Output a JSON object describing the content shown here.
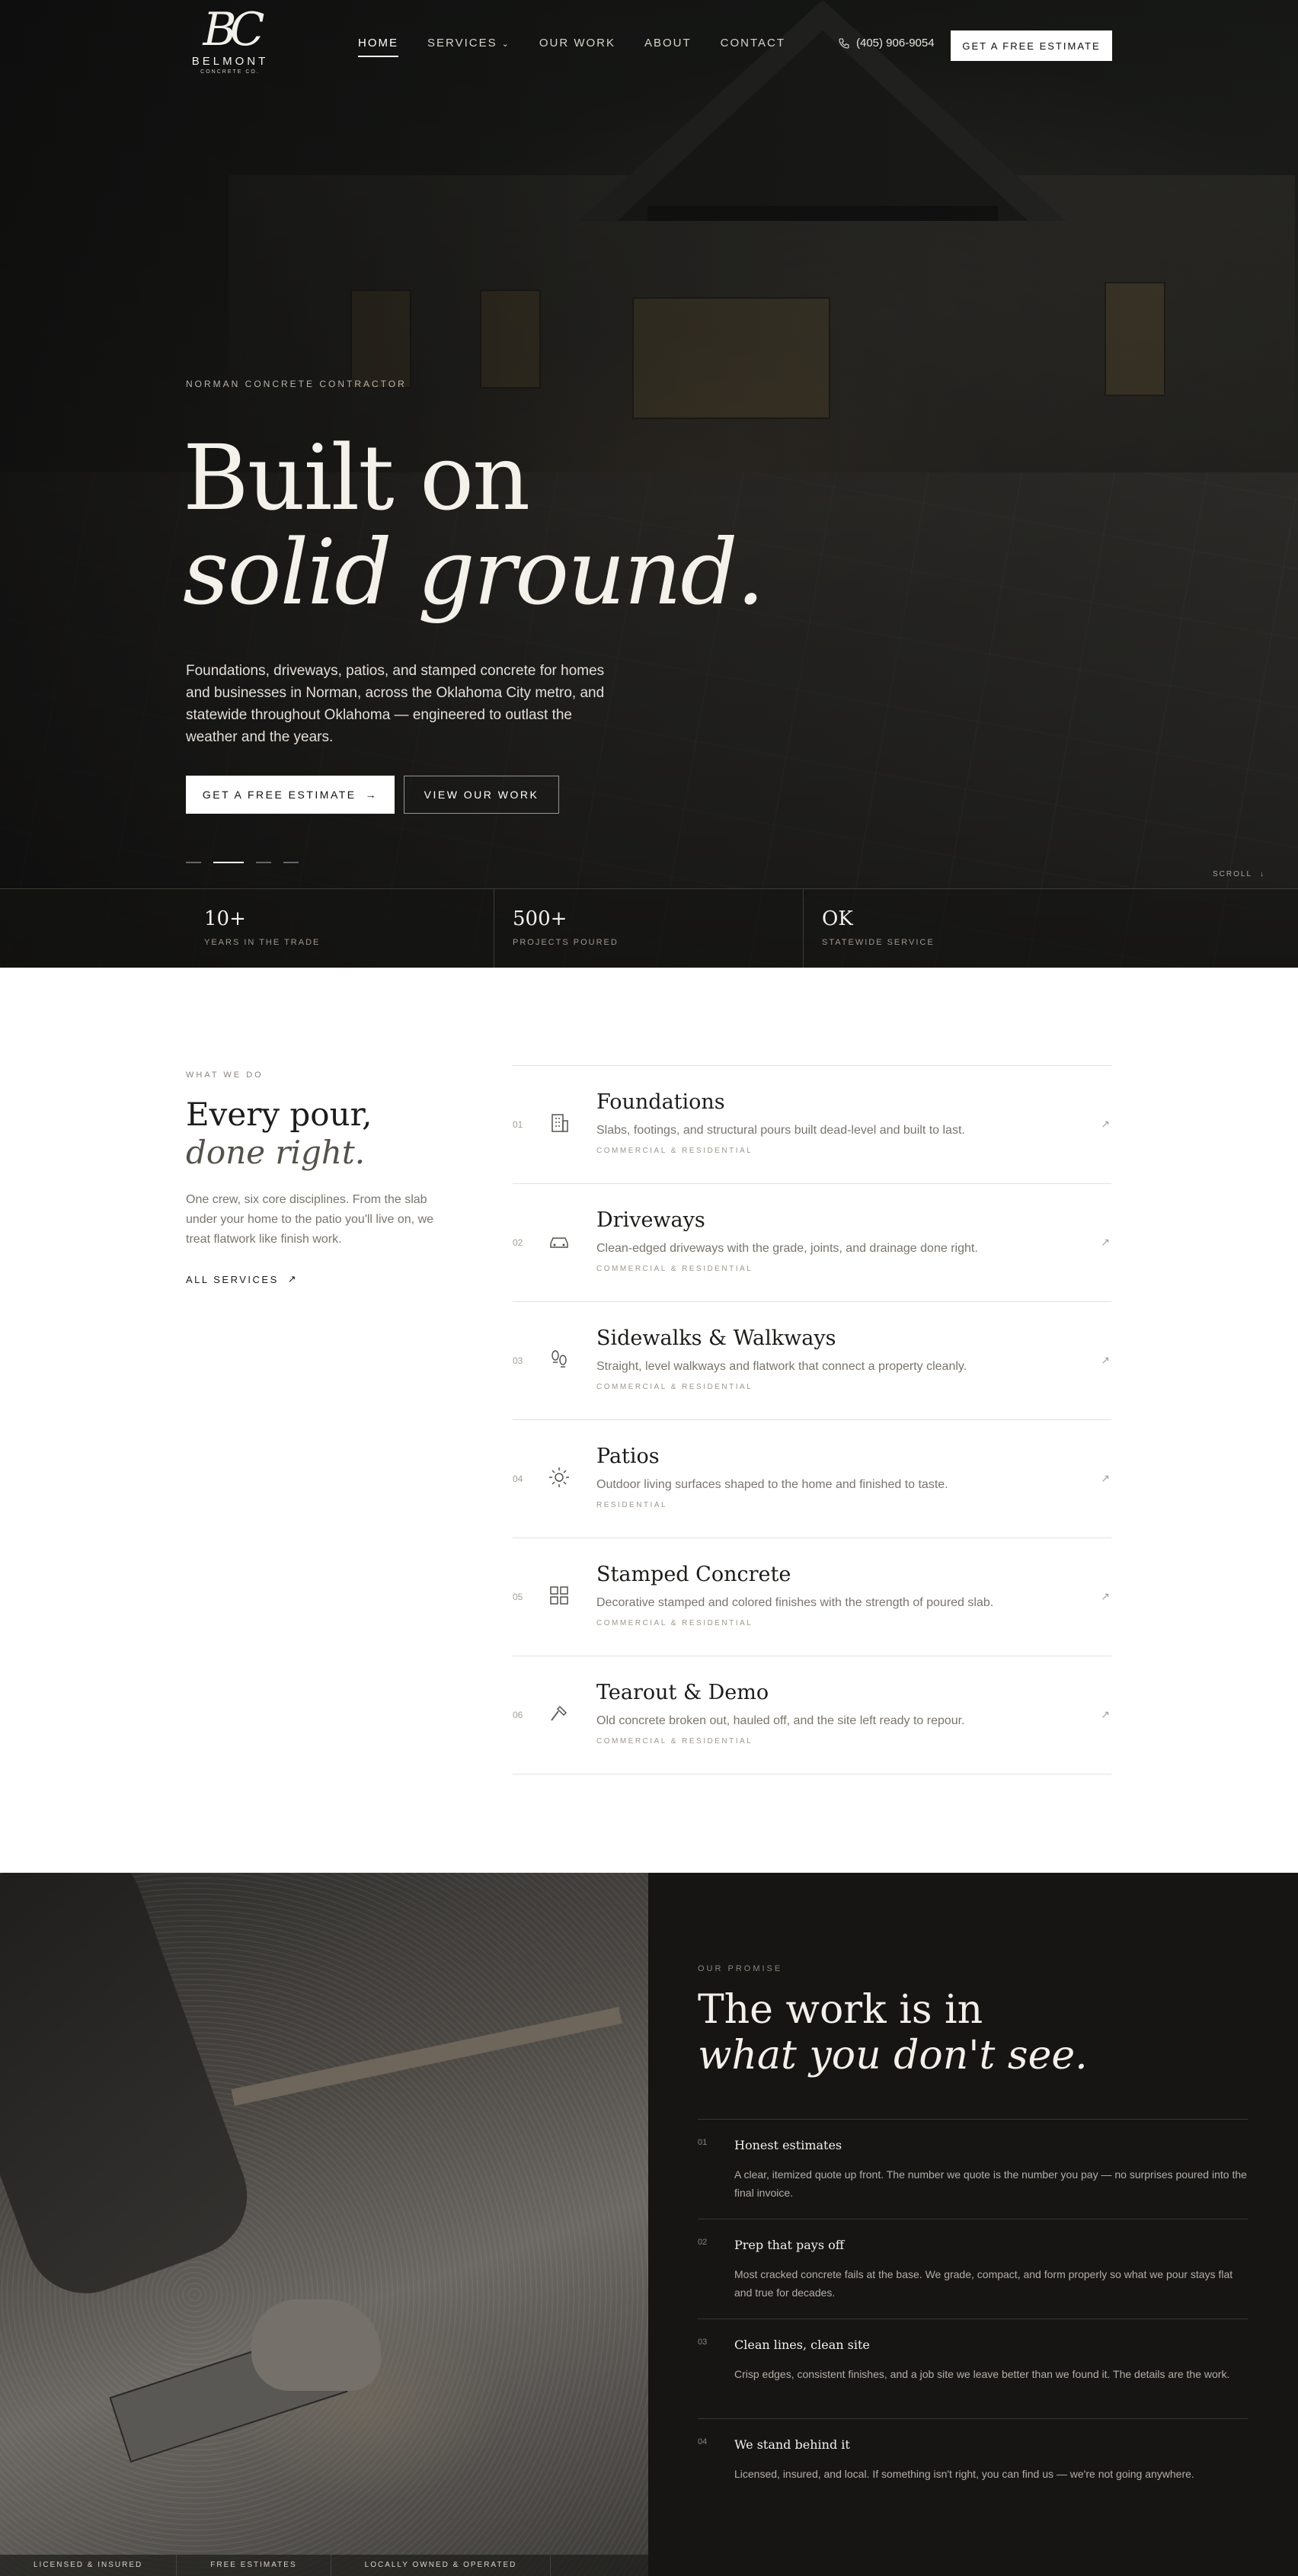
{
  "brand": {
    "mark": "BC",
    "name": "BELMONT",
    "subtitle": "CONCRETE CO."
  },
  "nav": {
    "items": [
      {
        "label": "HOME",
        "active": true
      },
      {
        "label": "SERVICES",
        "has_dropdown": true
      },
      {
        "label": "OUR WORK"
      },
      {
        "label": "ABOUT"
      },
      {
        "label": "CONTACT"
      }
    ],
    "phone": "(405) 906-9054",
    "cta": "GET A FREE ESTIMATE"
  },
  "hero": {
    "eyebrow": "NORMAN CONCRETE CONTRACTOR",
    "title_line1": "Built on",
    "title_line2": "solid ground.",
    "description": "Foundations, driveways, patios, and stamped concrete for homes and businesses in Norman, across the Oklahoma City metro, and statewide throughout Oklahoma — engineered to outlast the weather and the years.",
    "primary_cta": "GET A FREE ESTIMATE",
    "secondary_cta": "VIEW OUR WORK",
    "slide_count": 4,
    "active_slide": 2,
    "scroll_label": "SCROLL"
  },
  "stats": [
    {
      "value": "10+",
      "label": "YEARS IN THE TRADE"
    },
    {
      "value": "500+",
      "label": "PROJECTS POURED"
    },
    {
      "value": "OK",
      "label": "STATEWIDE SERVICE"
    }
  ],
  "services": {
    "eyebrow": "WHAT WE DO",
    "title_line1": "Every pour,",
    "title_line2": "done right.",
    "description": "One crew, six core disciplines. From the slab under your home to the patio you'll live on, we treat flatwork like finish work.",
    "all_link": "ALL SERVICES",
    "items": [
      {
        "num": "01",
        "icon": "building-icon",
        "name": "Foundations",
        "text": "Slabs, footings, and structural pours built dead-level and built to last.",
        "tag": "COMMERCIAL & RESIDENTIAL"
      },
      {
        "num": "02",
        "icon": "car-icon",
        "name": "Driveways",
        "text": "Clean-edged driveways with the grade, joints, and drainage done right.",
        "tag": "COMMERCIAL & RESIDENTIAL"
      },
      {
        "num": "03",
        "icon": "footprints-icon",
        "name": "Sidewalks & Walkways",
        "text": "Straight, level walkways and flatwork that connect a property cleanly.",
        "tag": "COMMERCIAL & RESIDENTIAL"
      },
      {
        "num": "04",
        "icon": "sun-icon",
        "name": "Patios",
        "text": "Outdoor living surfaces shaped to the home and finished to taste.",
        "tag": "RESIDENTIAL"
      },
      {
        "num": "05",
        "icon": "grid-icon",
        "name": "Stamped Concrete",
        "text": "Decorative stamped and colored finishes with the strength of poured slab.",
        "tag": "COMMERCIAL & RESIDENTIAL"
      },
      {
        "num": "06",
        "icon": "hammer-icon",
        "name": "Tearout & Demo",
        "text": "Old concrete broken out, hauled off, and the site left ready to repour.",
        "tag": "COMMERCIAL & RESIDENTIAL"
      }
    ]
  },
  "promise": {
    "eyebrow": "OUR PROMISE",
    "title_line1": "The work is in",
    "title_line2": "what you don't see.",
    "items": [
      {
        "num": "01",
        "name": "Honest estimates",
        "text": "A clear, itemized quote up front. The number we quote is the number you pay — no surprises poured into the final invoice."
      },
      {
        "num": "02",
        "name": "Prep that pays off",
        "text": "Most cracked concrete fails at the base. We grade, compact, and form properly so what we pour stays flat and true for decades."
      },
      {
        "num": "03",
        "name": "Clean lines, clean site",
        "text": "Crisp edges, consistent finishes, and a job site we leave better than we found it. The details are the work."
      },
      {
        "num": "04",
        "name": "We stand behind it",
        "text": "Licensed, insured, and local. If something isn't right, you can find us — we're not going anywhere."
      }
    ],
    "badges": [
      "LICENSED & INSURED",
      "FREE ESTIMATES",
      "LOCALLY OWNED & OPERATED"
    ]
  }
}
